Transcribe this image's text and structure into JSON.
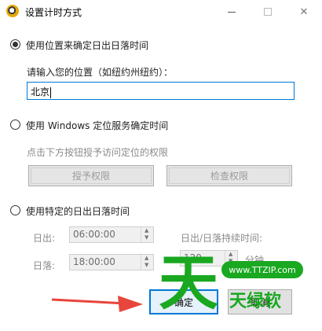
{
  "window": {
    "title": "设置计时方式",
    "minimize": "–",
    "maximize": "☐",
    "close": "✕"
  },
  "option_location": {
    "label": "使用位置来确定日出日落时间",
    "checked": true,
    "prompt": "请输入您的位置（如纽约州纽约）：",
    "value": "北京"
  },
  "option_windows": {
    "label": "使用 Windows 定位服务确定时间",
    "hint": "点击下方按钮授予访问定位的权限",
    "grant_button": "授予权限",
    "check_button": "检查权限"
  },
  "option_specific": {
    "label": "使用特定的日出日落时间",
    "sunrise_label": "日出:",
    "sunrise_value": "06:00:00",
    "sunset_label": "日落:",
    "sunset_value": "18:00:00",
    "duration_label": "日出/日落持续时间:",
    "duration_value": "120",
    "duration_unit": "分钟"
  },
  "buttons": {
    "ok": "确定",
    "cancel": "取消"
  },
  "watermark": {
    "char": "天",
    "url": "www.TTZIP.com",
    "text": "天绿软"
  },
  "colors": {
    "accent": "#0078d7",
    "watermark": "#1aa821",
    "arrow": "#e8453c"
  },
  "icons": {
    "app": "app-icon",
    "arrow": "red-pointer-arrow"
  }
}
